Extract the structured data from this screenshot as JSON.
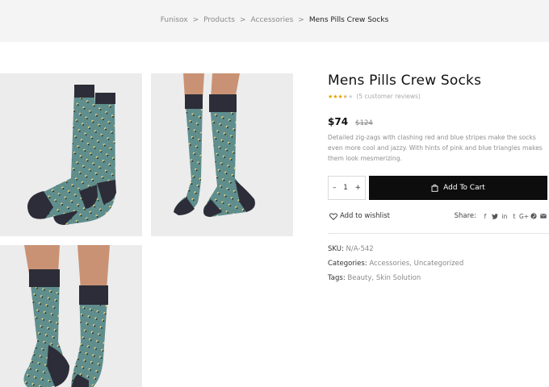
{
  "breadcrumb": {
    "home": "Funisox",
    "sep": ">",
    "products": "Products",
    "accessories": "Accessories",
    "current": "Mens Pills Crew Socks"
  },
  "product": {
    "title": "Mens Pills Crew Socks",
    "rating": 3.5,
    "reviews": "(5 customer reviews)",
    "price": "$74",
    "old_price": "$124",
    "description": "Detailed zig-zags with clashing red and blue stripes make the socks even more cool and jazzy. With hints of pink and blue triangles makes them look mesmerizing.",
    "quantity": "1",
    "qty_minus": "–",
    "qty_plus": "+",
    "add_to_cart": "Add To Cart",
    "wishlist": "Add to wishlist",
    "share_label": "Share:"
  },
  "meta": {
    "sku_label": "SKU:",
    "sku": "N/A-542",
    "categories_label": "Categories:",
    "category_1": "Accessories",
    "category_sep": ",",
    "category_2": "Uncategorized",
    "tags_label": "Tags:",
    "tag_1": "Beauty",
    "tag_sep": ",",
    "tag_2": "Skin Solution"
  },
  "share_icons": [
    "facebook-icon",
    "twitter-icon",
    "linkedin-icon",
    "tumblr-icon",
    "google-plus-icon",
    "pinterest-icon",
    "email-icon"
  ],
  "colors": {
    "sock_teal": "#5f8e8d",
    "sock_dark": "#2c2d38",
    "accent_black": "#0d0d0d",
    "star": "#e2a400"
  }
}
